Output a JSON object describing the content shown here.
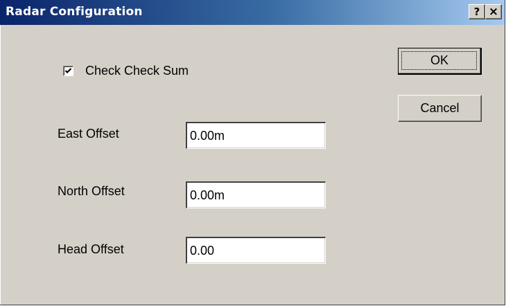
{
  "window": {
    "title": "Radar Configuration",
    "help_button": "?",
    "close_button": "×"
  },
  "checkbox": {
    "label": "Check Check Sum",
    "checked": true
  },
  "fields": {
    "east": {
      "label": "East Offset",
      "value": "0.00m"
    },
    "north": {
      "label": "North Offset",
      "value": "0.00m"
    },
    "head": {
      "label": "Head Offset",
      "value": "0.00"
    }
  },
  "buttons": {
    "ok": "OK",
    "cancel": "Cancel"
  },
  "icons": {
    "checkmark": "checkmark-icon",
    "help": "help-icon",
    "close": "close-icon"
  },
  "colors": {
    "titlebar_start": "#0a246a",
    "titlebar_end": "#a6caf0",
    "face": "#d4d0c8"
  }
}
